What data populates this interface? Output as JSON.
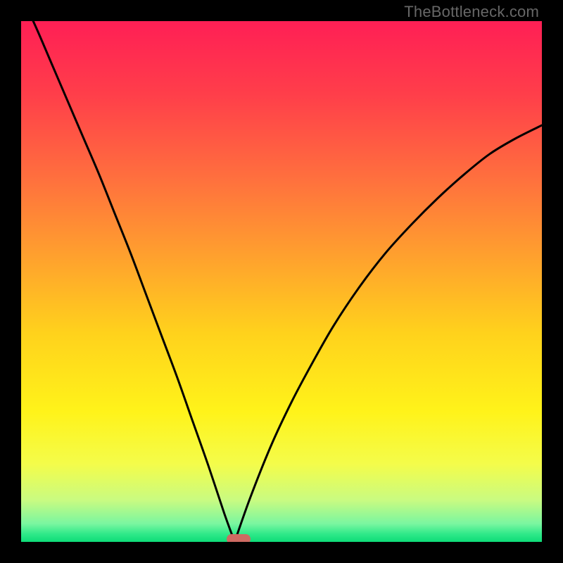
{
  "watermark": "TheBottleneck.com",
  "colors": {
    "black": "#000000",
    "marker": "#ce6a62",
    "curve": "#000000",
    "gradient_stops": [
      {
        "offset": 0.0,
        "color": "#ff1f55"
      },
      {
        "offset": 0.14,
        "color": "#ff3e4a"
      },
      {
        "offset": 0.3,
        "color": "#ff6f3e"
      },
      {
        "offset": 0.45,
        "color": "#ffa02e"
      },
      {
        "offset": 0.6,
        "color": "#ffd21c"
      },
      {
        "offset": 0.75,
        "color": "#fff31a"
      },
      {
        "offset": 0.85,
        "color": "#f4fc4a"
      },
      {
        "offset": 0.92,
        "color": "#c9fb81"
      },
      {
        "offset": 0.965,
        "color": "#7af6a0"
      },
      {
        "offset": 0.985,
        "color": "#2fe989"
      },
      {
        "offset": 1.0,
        "color": "#0ddc78"
      }
    ]
  },
  "chart_data": {
    "type": "line",
    "title": "",
    "xlabel": "",
    "ylabel": "",
    "xlim": [
      0,
      1
    ],
    "ylim": [
      0,
      1
    ],
    "min_x": 0.41,
    "marker_x_range": [
      0.395,
      0.44
    ],
    "series": [
      {
        "name": "left-branch",
        "x": [
          0.0,
          0.03,
          0.06,
          0.09,
          0.12,
          0.15,
          0.18,
          0.21,
          0.24,
          0.27,
          0.3,
          0.33,
          0.36,
          0.39,
          0.41
        ],
        "values": [
          1.05,
          0.985,
          0.915,
          0.845,
          0.775,
          0.705,
          0.63,
          0.555,
          0.475,
          0.395,
          0.315,
          0.23,
          0.145,
          0.055,
          0.0
        ]
      },
      {
        "name": "right-branch",
        "x": [
          0.41,
          0.44,
          0.48,
          0.52,
          0.56,
          0.6,
          0.65,
          0.7,
          0.75,
          0.8,
          0.85,
          0.9,
          0.95,
          1.0
        ],
        "values": [
          0.0,
          0.085,
          0.185,
          0.27,
          0.345,
          0.415,
          0.49,
          0.555,
          0.61,
          0.66,
          0.705,
          0.745,
          0.775,
          0.8
        ]
      }
    ]
  }
}
